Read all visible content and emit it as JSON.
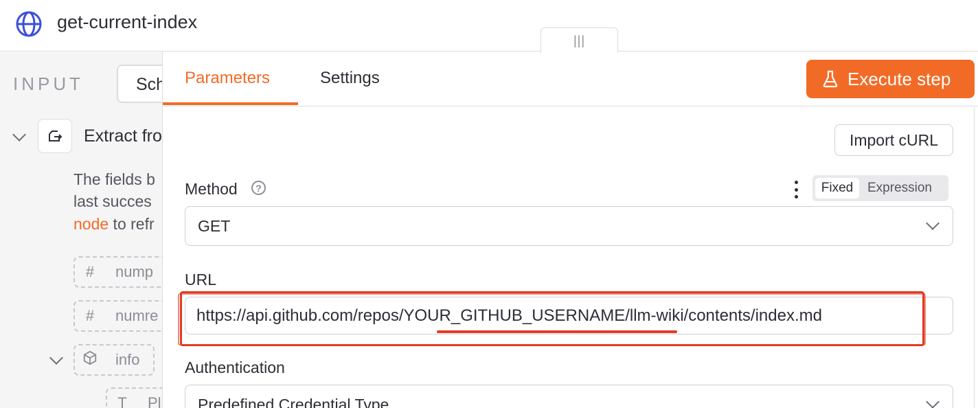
{
  "header": {
    "title": "get-current-index",
    "icon": "globe-icon"
  },
  "left_panel": {
    "section_label": "INPUT",
    "schema_tab": "Sch",
    "extract_label": "Extract fro",
    "desc_line1": "The fields b",
    "desc_line2": "last succes",
    "desc_link": "node",
    "desc_line3_rest": " to refr",
    "fields": [
      {
        "symbol": "#",
        "name": "nump"
      },
      {
        "symbol": "#",
        "name": "numre"
      },
      {
        "symbol": "cube",
        "name": "info"
      },
      {
        "symbol": "T",
        "name": "Pl"
      }
    ]
  },
  "drag_handle": "|||",
  "tabs": {
    "parameters": "Parameters",
    "settings": "Settings"
  },
  "execute_button": "Execute step",
  "import_button": "Import cURL",
  "method": {
    "label": "Method",
    "toggle_fixed": "Fixed",
    "toggle_expression": "Expression",
    "value": "GET"
  },
  "url": {
    "label": "URL",
    "value": "https://api.github.com/repos/YOUR_GITHUB_USERNAME/llm-wiki/contents/index.md"
  },
  "authentication": {
    "label": "Authentication",
    "value": "Predefined Credential Type"
  },
  "colors": {
    "accent": "#f26b26",
    "annotation": "#e23a24",
    "globe": "#3b4ed8"
  }
}
